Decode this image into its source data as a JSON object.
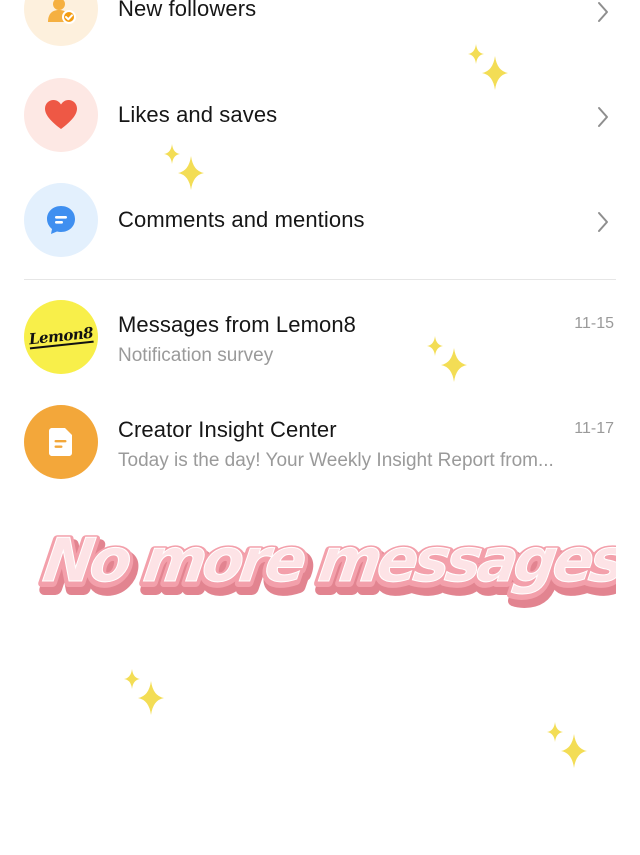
{
  "notifications": {
    "new_followers": "New followers",
    "likes_and_saves": "Likes and saves",
    "comments_and_mentions": "Comments and mentions"
  },
  "messages": [
    {
      "sender": "Messages from Lemon8",
      "preview": "Notification survey",
      "date": "11-15",
      "avatar_text": "Lemon8"
    },
    {
      "sender": "Creator Insight Center",
      "preview": "Today is the day! Your Weekly Insight Report from...",
      "date": "11-17"
    }
  ],
  "overlay": {
    "text": "No more messages!"
  },
  "colors": {
    "followers_bg": "#fdf0dd",
    "likes_bg": "#fde8e4",
    "comments_bg": "#e3f0fd",
    "lemon8_yellow": "#f8ef4a",
    "insight_orange": "#f3a73a",
    "sparkle": "#f3dd55",
    "overlay_fill": "#fde3e6",
    "overlay_stroke": "#e07a87"
  },
  "icons": [
    "person-check-icon",
    "heart-icon",
    "chat-bubble-icon",
    "document-icon",
    "chevron-right-icon",
    "sparkle-icon"
  ]
}
